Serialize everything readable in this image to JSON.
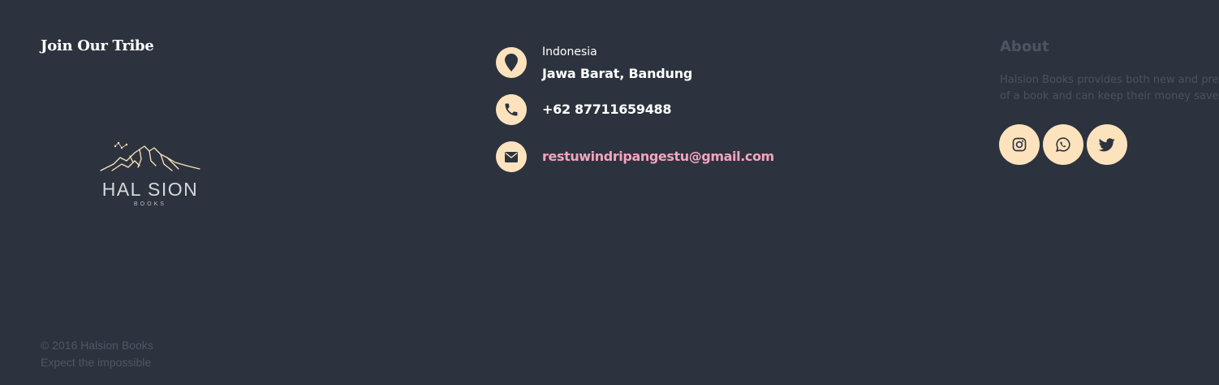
{
  "join": {
    "title": "Join Our Tribe"
  },
  "logo": {
    "word": "HAL SION",
    "sub": "BOOKS"
  },
  "copyright": {
    "line1": "© 2016 Halsion Books",
    "line2": "Expect the impossible"
  },
  "contact": {
    "country": "Indonesia",
    "city": "Jawa Barat, Bandung",
    "phone": "+62 87711659488",
    "email": "restuwindripangestu@gmail.com"
  },
  "about": {
    "title": "About",
    "line1": "Halsion Books provides both new and pre",
    "line2": "of a book and can keep their money save"
  },
  "social": [
    {
      "name": "instagram-icon"
    },
    {
      "name": "whatsapp-icon"
    },
    {
      "name": "twitter-icon"
    }
  ],
  "colors": {
    "background": "#2c333e",
    "accent": "#fde3bd",
    "email": "#f5a3bd",
    "muted": "#4f5764"
  }
}
